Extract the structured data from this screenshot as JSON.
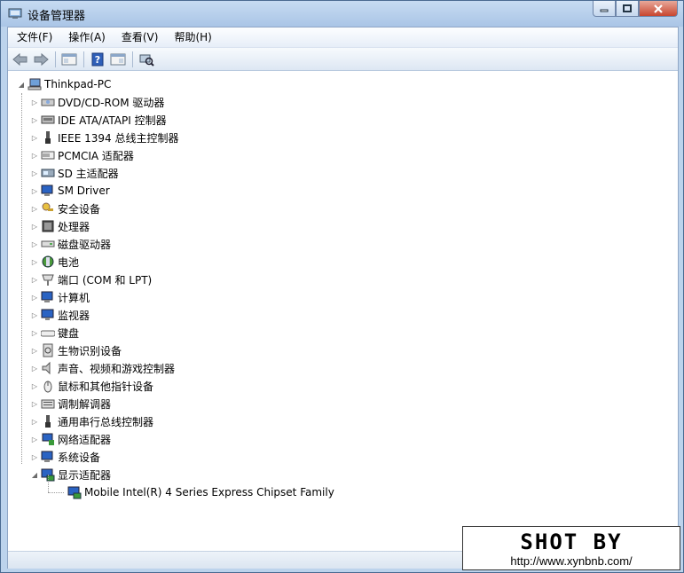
{
  "window": {
    "title": "设备管理器"
  },
  "menu": [
    "文件(F)",
    "操作(A)",
    "查看(V)",
    "帮助(H)"
  ],
  "toolbar": [
    "back-icon",
    "forward-icon",
    "properties-icon",
    "help-icon",
    "view-icon",
    "scan-icon"
  ],
  "tree": {
    "root": "Thinkpad-PC",
    "categories": [
      {
        "label": "DVD/CD-ROM 驱动器",
        "icon": "dvd-drive-icon"
      },
      {
        "label": "IDE ATA/ATAPI 控制器",
        "icon": "ide-controller-icon"
      },
      {
        "label": "IEEE 1394 总线主控制器",
        "icon": "ieee1394-icon"
      },
      {
        "label": "PCMCIA 适配器",
        "icon": "pcmcia-icon"
      },
      {
        "label": "SD 主适配器",
        "icon": "sd-host-icon"
      },
      {
        "label": "SM Driver",
        "icon": "sm-driver-icon"
      },
      {
        "label": "安全设备",
        "icon": "security-device-icon"
      },
      {
        "label": "处理器",
        "icon": "processor-icon"
      },
      {
        "label": "磁盘驱动器",
        "icon": "disk-drive-icon"
      },
      {
        "label": "电池",
        "icon": "battery-icon"
      },
      {
        "label": "端口 (COM 和 LPT)",
        "icon": "port-icon"
      },
      {
        "label": "计算机",
        "icon": "computer-icon"
      },
      {
        "label": "监视器",
        "icon": "monitor-icon"
      },
      {
        "label": "键盘",
        "icon": "keyboard-icon"
      },
      {
        "label": "生物识别设备",
        "icon": "biometric-icon"
      },
      {
        "label": "声音、视频和游戏控制器",
        "icon": "sound-icon"
      },
      {
        "label": "鼠标和其他指针设备",
        "icon": "mouse-icon"
      },
      {
        "label": "调制解调器",
        "icon": "modem-icon"
      },
      {
        "label": "通用串行总线控制器",
        "icon": "usb-icon"
      },
      {
        "label": "网络适配器",
        "icon": "network-adapter-icon"
      },
      {
        "label": "系统设备",
        "icon": "system-device-icon"
      },
      {
        "label": "显示适配器",
        "icon": "display-adapter-icon",
        "expanded": true
      }
    ],
    "child": "Mobile Intel(R) 4 Series Express Chipset Family"
  },
  "watermark": {
    "title": "SHOT BY",
    "url": "http://www.xynbnb.com/"
  },
  "colors": {
    "titlebar": "#bcd3ec",
    "close": "#c8452f",
    "selected": "#3399ff"
  }
}
